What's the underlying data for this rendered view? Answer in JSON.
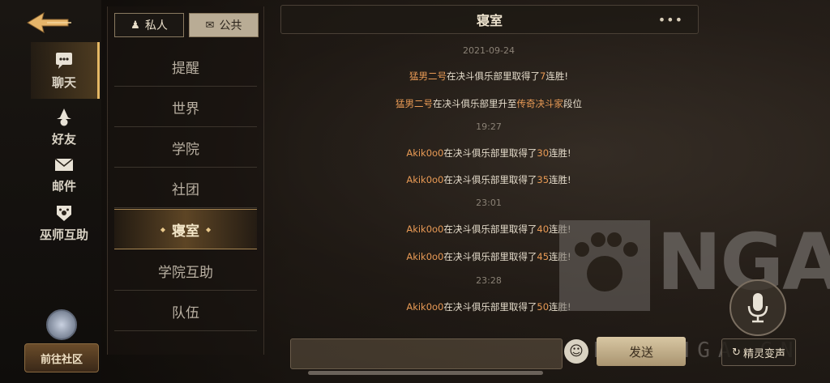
{
  "left_nav": {
    "items": [
      {
        "label": "聊天",
        "icon": "chat-bubble-icon",
        "active": true
      },
      {
        "label": "好友",
        "icon": "wizard-hat-icon",
        "active": false
      },
      {
        "label": "邮件",
        "icon": "envelope-icon",
        "active": false
      },
      {
        "label": "巫师互助",
        "icon": "paw-badge-icon",
        "active": false
      }
    ],
    "community_label": "前往社区"
  },
  "tabs": [
    {
      "label": "私人",
      "icon": "person-icon",
      "active": false
    },
    {
      "label": "公共",
      "icon": "group-chat-icon",
      "active": true
    }
  ],
  "channels": [
    {
      "label": "提醒"
    },
    {
      "label": "世界"
    },
    {
      "label": "学院"
    },
    {
      "label": "社团"
    },
    {
      "label": "寝室",
      "active": true
    },
    {
      "label": "学院互助"
    },
    {
      "label": "队伍"
    }
  ],
  "chat": {
    "title": "寝室",
    "more": "•••",
    "feed": [
      {
        "type": "timestamp",
        "text": "2021-09-24"
      },
      {
        "type": "message",
        "name": "猛男二号",
        "pre": "在决斗俱乐部里取得了",
        "highlight": "7",
        "post": "连胜!"
      },
      {
        "type": "message",
        "name": "猛男二号",
        "pre": "在决斗俱乐部里升至",
        "highlight": "传奇决斗家",
        "post": "段位"
      },
      {
        "type": "timestamp",
        "text": "19:27"
      },
      {
        "type": "message",
        "name": "Akik0o0",
        "pre": "在决斗俱乐部里取得了",
        "highlight": "30",
        "post": "连胜!"
      },
      {
        "type": "message",
        "name": "Akik0o0",
        "pre": "在决斗俱乐部里取得了",
        "highlight": "35",
        "post": "连胜!"
      },
      {
        "type": "timestamp",
        "text": "23:01"
      },
      {
        "type": "message",
        "name": "Akik0o0",
        "pre": "在决斗俱乐部里取得了",
        "highlight": "40",
        "post": "连胜!"
      },
      {
        "type": "message",
        "name": "Akik0o0",
        "pre": "在决斗俱乐部里取得了",
        "highlight": "45",
        "post": "连胜!"
      },
      {
        "type": "timestamp",
        "text": "23:28"
      },
      {
        "type": "message",
        "name": "Akik0o0",
        "pre": "在决斗俱乐部里取得了",
        "highlight": "50",
        "post": "连胜!"
      }
    ]
  },
  "input": {
    "value": "",
    "placeholder": "",
    "emoji_icon": "smiley-icon",
    "send_label": "发送",
    "voice_label": "精灵变声",
    "mic_icon": "microphone-icon"
  },
  "watermark": {
    "brand": "NGA",
    "domain": "BBS.NGA.CN"
  },
  "colors": {
    "accent_gold": "#e4b764",
    "highlight_orange": "#e89a55",
    "tab_active_bg": "#b9ac95"
  }
}
